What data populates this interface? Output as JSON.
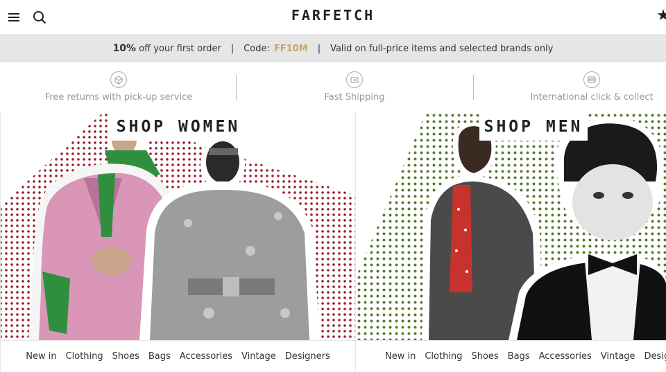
{
  "header": {
    "logo": "FARFETCH",
    "icons": [
      "menu-icon",
      "search-icon",
      "star-icon"
    ]
  },
  "promo": {
    "discount": "10%",
    "discount_text": "off your first order",
    "separator": "|",
    "code_label": "Code:",
    "code": "FF10M",
    "validity": "Valid on full-price items and selected brands only"
  },
  "services": [
    {
      "label": "Free returns with pick-up service",
      "icon": "box-icon"
    },
    {
      "label": "Fast Shipping",
      "icon": "shipping-icon"
    },
    {
      "label": "International click & collect",
      "icon": "card-icon"
    }
  ],
  "women": {
    "title": "SHOP WOMEN",
    "nav": [
      "New in",
      "Clothing",
      "Shoes",
      "Bags",
      "Accessories",
      "Vintage",
      "Designers"
    ]
  },
  "men": {
    "title": "SHOP MEN",
    "nav": [
      "New in",
      "Clothing",
      "Shoes",
      "Bags",
      "Accessories",
      "Vintage",
      "Designers"
    ]
  },
  "colors": {
    "promo_code": "#c9a56e",
    "women_dots": "#9c1d2a",
    "men_dots": "#5b7a2e",
    "promo_bg": "#e6e6e6"
  }
}
